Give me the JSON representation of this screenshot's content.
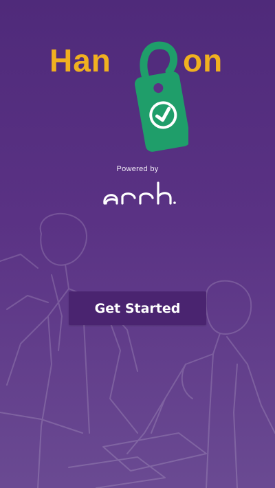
{
  "logo": {
    "text_left": "Han",
    "text_right": "on",
    "icon": "door-hanger-check-icon",
    "colors": {
      "text": "#f0b020",
      "tag": "#1f9e6a",
      "check": "#ffffff"
    }
  },
  "powered_by": {
    "label": "Powered by",
    "brand_logo": "arrk-logo"
  },
  "cta": {
    "label": "Get Started"
  },
  "colors": {
    "background": "#5a3284",
    "button": "#4a2470",
    "button_text": "#ffffff"
  },
  "background_art": "office-workers-line-art"
}
